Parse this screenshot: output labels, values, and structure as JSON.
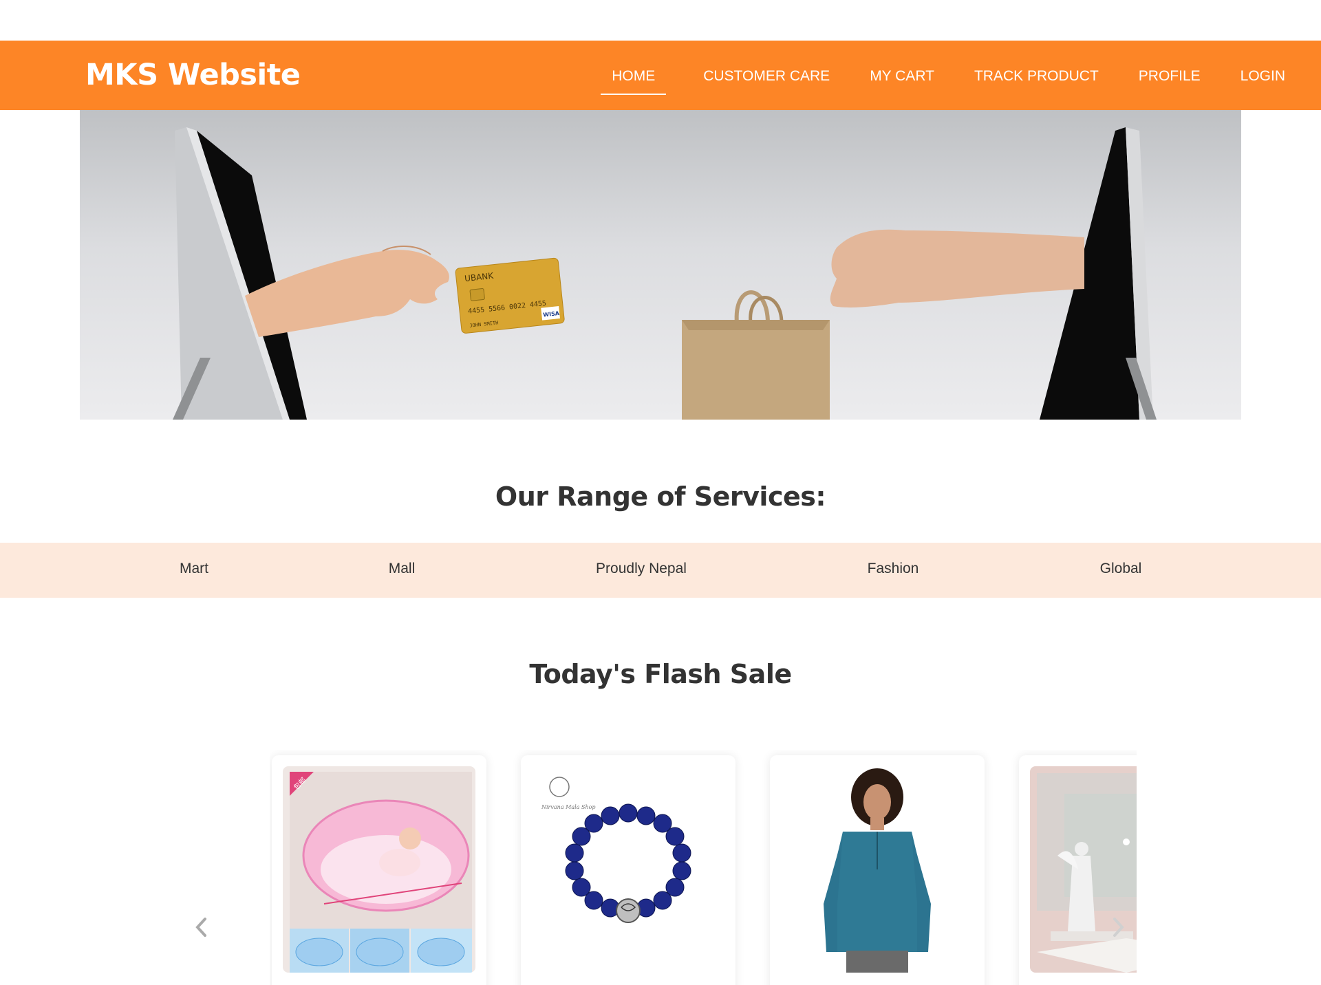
{
  "header": {
    "brand": "MKS Website",
    "nav": [
      {
        "label": "HOME",
        "active": true
      },
      {
        "label": "CUSTOMER CARE"
      },
      {
        "label": "MY CART"
      },
      {
        "label": "TRACK PRODUCT"
      },
      {
        "label": "PROFILE"
      },
      {
        "label": "LOGIN"
      }
    ]
  },
  "hero": {
    "card_text": {
      "bank": "UBANK",
      "number": "4455 5566 0022 4455",
      "holder": "JOHN SMITH",
      "network": "WISA"
    }
  },
  "services": {
    "title": "Our Range of Services:",
    "items": [
      "Mart",
      "Mall",
      "Proudly Nepal",
      "Fashion",
      "Global"
    ]
  },
  "flash_sale": {
    "title": "Today's Flash Sale",
    "products": [
      {
        "image": "baby-mosquito-net-bed",
        "badge": "包邮"
      },
      {
        "image": "lapis-bead-bracelet",
        "brand_mark": "Nirvana Mala Shop"
      },
      {
        "image": "teal-lace-up-tunic"
      },
      {
        "image": "angel-figurine"
      }
    ]
  },
  "colors": {
    "brand_orange": "#fd8526",
    "services_bg": "#fde9dc",
    "heading": "#333333"
  }
}
